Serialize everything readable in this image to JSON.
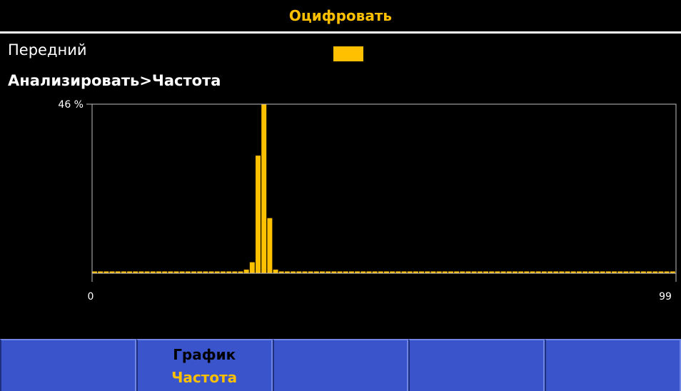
{
  "title": "Оцифровать",
  "trace": {
    "name": "Передний",
    "color": "#ffc000"
  },
  "analysis_path": "Анализировать>Частота",
  "softkeys": [
    {
      "line1": "",
      "line2": ""
    },
    {
      "line1": "График",
      "line2": "Частота"
    },
    {
      "line1": "",
      "line2": ""
    },
    {
      "line1": "",
      "line2": ""
    },
    {
      "line1": "",
      "line2": ""
    }
  ],
  "chart_data": {
    "type": "bar",
    "y_max_label": "46 %",
    "x_min_label": "0",
    "x_max_label": "99",
    "xlim": [
      0,
      99
    ],
    "ylim": [
      0,
      46
    ],
    "x": [
      0,
      1,
      2,
      3,
      4,
      5,
      6,
      7,
      8,
      9,
      10,
      11,
      12,
      13,
      14,
      15,
      16,
      17,
      18,
      19,
      20,
      21,
      22,
      23,
      24,
      25,
      26,
      27,
      28,
      29,
      30,
      31,
      32,
      33,
      34,
      35,
      36,
      37,
      38,
      39,
      40,
      41,
      42,
      43,
      44,
      45,
      46,
      47,
      48,
      49,
      50,
      51,
      52,
      53,
      54,
      55,
      56,
      57,
      58,
      59,
      60,
      61,
      61,
      63,
      64,
      65,
      66,
      67,
      68,
      69,
      70,
      71,
      72,
      73,
      74,
      75,
      76,
      77,
      78,
      79,
      80,
      81,
      82,
      83,
      84,
      85,
      86,
      87,
      88,
      89,
      90,
      91,
      92,
      93,
      94,
      95,
      96,
      97,
      98,
      99
    ],
    "values": [
      0.5,
      0.5,
      0.5,
      0.5,
      0.5,
      0.5,
      0.5,
      0.5,
      0.5,
      0.5,
      0.5,
      0.5,
      0.5,
      0.5,
      0.5,
      0.5,
      0.5,
      0.5,
      0.5,
      0.5,
      0.5,
      0.5,
      0.5,
      0.5,
      0.5,
      0.5,
      1.0,
      3.0,
      32.0,
      46.0,
      15.0,
      1.0,
      0.5,
      0.5,
      0.5,
      0.5,
      0.5,
      0.5,
      0.5,
      0.5,
      0.5,
      0.5,
      0.5,
      0.5,
      0.5,
      0.5,
      0.5,
      0.5,
      0.5,
      0.5,
      0.5,
      0.5,
      0.5,
      0.5,
      0.5,
      0.5,
      0.5,
      0.5,
      0.5,
      0.5,
      0.5,
      0.5,
      0.5,
      0.5,
      0.5,
      0.5,
      0.5,
      0.5,
      0.5,
      0.5,
      0.5,
      0.5,
      0.5,
      0.5,
      0.5,
      0.5,
      0.5,
      0.5,
      0.5,
      0.5,
      0.5,
      0.5,
      0.5,
      0.5,
      0.5,
      0.5,
      0.5,
      0.5,
      0.5,
      0.5,
      0.5,
      0.5,
      0.5,
      0.5,
      0.5,
      0.5,
      0.5,
      0.5,
      0.5,
      0.5
    ],
    "grid": false,
    "color": "#ffc000"
  }
}
